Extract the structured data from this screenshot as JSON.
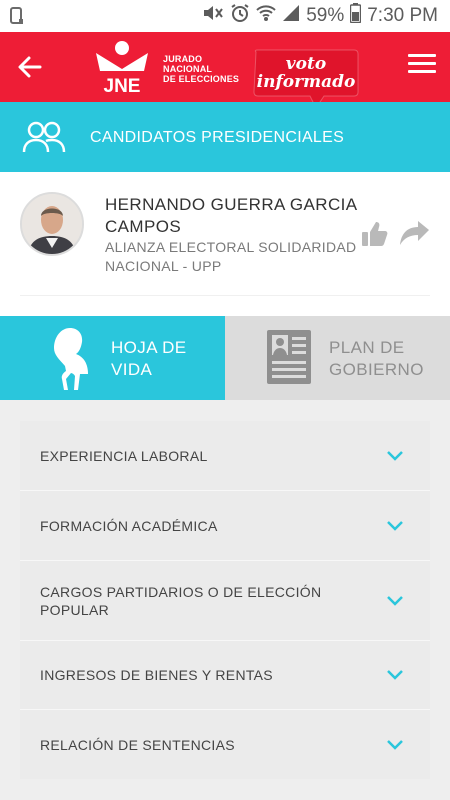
{
  "status_bar": {
    "battery": "59%",
    "time": "7:30 PM",
    "icons": [
      "notification-icon",
      "mute-icon",
      "alarm-icon",
      "wifi-icon",
      "signal-icon",
      "battery-icon"
    ]
  },
  "header": {
    "logo_text": "JNE",
    "org_name_line1": "JURADO",
    "org_name_line2": "NACIONAL",
    "org_name_line3": "DE ELECCIONES",
    "badge_line1": "voto",
    "badge_line2": "informado",
    "accent_color": "#ee1d36"
  },
  "section": {
    "title": "CANDIDATOS PRESIDENCIALES",
    "color": "#2ac6dc"
  },
  "candidate": {
    "name": "HERNANDO GUERRA GARCIA CAMPOS",
    "party": "ALIANZA ELECTORAL SOLIDARIDAD NACIONAL - UPP"
  },
  "tabs": [
    {
      "label": "HOJA DE VIDA",
      "active": true,
      "icon": "person-silhouette-icon"
    },
    {
      "label": "PLAN DE GOBIERNO",
      "active": false,
      "icon": "document-profile-icon"
    }
  ],
  "accordion": {
    "items": [
      {
        "label": "EXPERIENCIA LABORAL"
      },
      {
        "label": "FORMACIÓN ACADÉMICA"
      },
      {
        "label": "CARGOS PARTIDARIOS O DE ELECCIÓN POPULAR"
      },
      {
        "label": "INGRESOS DE BIENES Y RENTAS"
      },
      {
        "label": "RELACIÓN DE SENTENCIAS"
      }
    ]
  }
}
